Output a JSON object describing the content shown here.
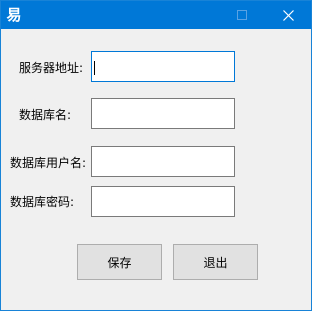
{
  "window": {
    "app_icon_glyph": "易",
    "title_bar_color": "#0078d7",
    "controls": {
      "minimize_icon": "minimize-icon",
      "maximize_icon": "maximize-icon",
      "close_icon": "close-icon"
    }
  },
  "form": {
    "server_address": {
      "label": "服务器地址:",
      "value": ""
    },
    "database_name": {
      "label": "数据库名:",
      "value": ""
    },
    "database_user": {
      "label": "数据库用户名:",
      "value": ""
    },
    "database_password": {
      "label": "数据库密码:",
      "value": ""
    }
  },
  "buttons": {
    "save_label": "保存",
    "exit_label": "退出"
  }
}
